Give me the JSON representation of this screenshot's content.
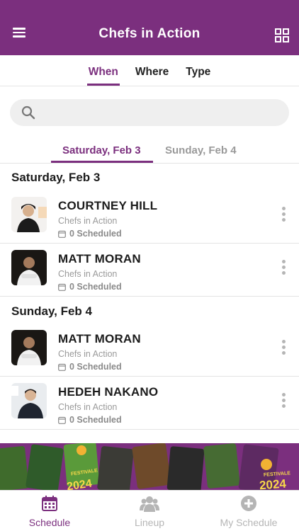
{
  "header": {
    "title": "Chefs in Action",
    "menu_icon": "hamburger-menu-icon",
    "grid_icon": "grid-view-icon",
    "brand_color": "#7b2f7e"
  },
  "filter_tabs": [
    {
      "label": "When",
      "active": true
    },
    {
      "label": "Where",
      "active": false
    },
    {
      "label": "Type",
      "active": false
    }
  ],
  "search": {
    "placeholder": "",
    "value": ""
  },
  "date_tabs": [
    {
      "label": "Saturday, Feb 3",
      "active": true
    },
    {
      "label": "Sunday, Feb 4",
      "active": false
    }
  ],
  "sections": [
    {
      "heading": "Saturday, Feb 3",
      "items": [
        {
          "name": "COURTNEY HILL",
          "category": "Chefs in Action",
          "scheduled": "0 Scheduled"
        },
        {
          "name": "MATT MORAN",
          "category": "Chefs in Action",
          "scheduled": "0 Scheduled"
        }
      ]
    },
    {
      "heading": "Sunday, Feb 4",
      "items": [
        {
          "name": "MATT MORAN",
          "category": "Chefs in Action",
          "scheduled": "0 Scheduled"
        },
        {
          "name": "HEDEH NAKANO",
          "category": "Chefs in Action",
          "scheduled": "0 Scheduled"
        }
      ]
    }
  ],
  "banner": {
    "badge_left": "2024",
    "badge_right": "2024",
    "badge_word": "FESTIVALE"
  },
  "bottom_nav": [
    {
      "label": "Schedule",
      "icon": "calendar-icon",
      "active": true
    },
    {
      "label": "Lineup",
      "icon": "people-icon",
      "active": false
    },
    {
      "label": "My Schedule",
      "icon": "plus-circle-icon",
      "active": false
    }
  ]
}
